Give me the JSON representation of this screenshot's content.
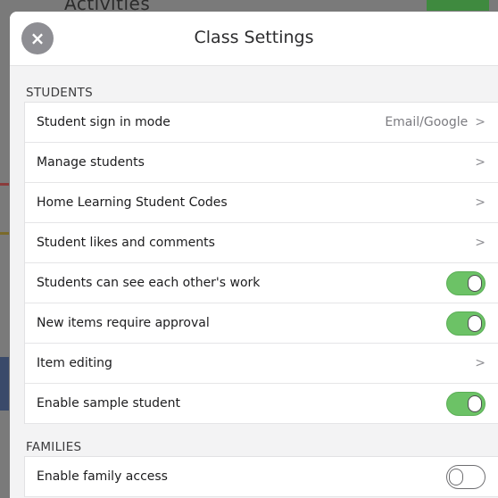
{
  "background": {
    "title_fragment": "Activities"
  },
  "modal": {
    "title": "Class Settings",
    "close_icon": "×"
  },
  "sections": {
    "students": {
      "header": "STUDENTS",
      "rows": [
        {
          "label": "Student sign in mode",
          "value": "Email/Google",
          "control": "chevron"
        },
        {
          "label": "Manage students",
          "control": "chevron"
        },
        {
          "label": "Home Learning Student Codes",
          "control": "chevron"
        },
        {
          "label": "Student likes and comments",
          "control": "chevron"
        },
        {
          "label": "Students can see each other's work",
          "control": "toggle",
          "on": true
        },
        {
          "label": "New items require approval",
          "control": "toggle",
          "on": true
        },
        {
          "label": "Item editing",
          "control": "chevron"
        },
        {
          "label": "Enable sample student",
          "control": "toggle",
          "on": true
        }
      ]
    },
    "families": {
      "header": "FAMILIES",
      "rows": [
        {
          "label": "Enable family access",
          "control": "toggle",
          "on": false
        }
      ]
    }
  },
  "glyphs": {
    "chevron": ">"
  },
  "colors": {
    "toggle_on": "#6cc266",
    "toggle_off": "#ffffff",
    "close_button": "#8e8e93"
  }
}
